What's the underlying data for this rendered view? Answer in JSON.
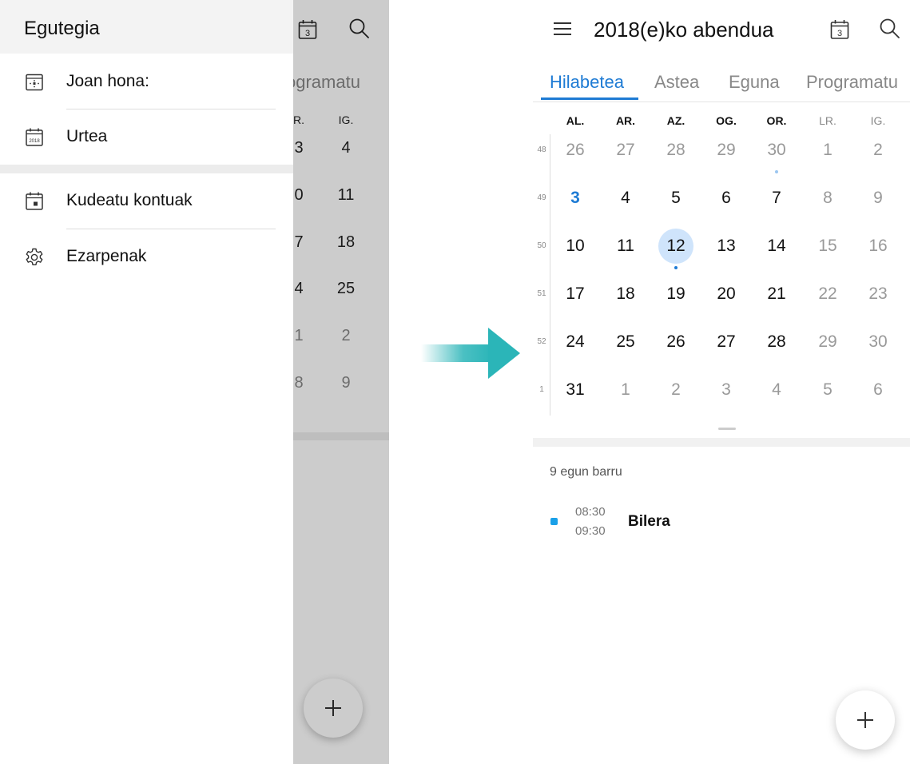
{
  "drawer": {
    "title": "Egutegia",
    "items": [
      {
        "label": "Joan hona:",
        "icon": "go-to-date-icon"
      },
      {
        "label": "Urtea",
        "icon": "year-calendar-icon",
        "icon_text": "2018"
      },
      {
        "label": "Kudeatu kontuak",
        "icon": "manage-accounts-calendar-icon"
      },
      {
        "label": "Ezarpenak",
        "icon": "gear-icon"
      }
    ]
  },
  "background": {
    "today_badge": "3",
    "tab_partial": "ogramatu",
    "weekdays": [
      "R.",
      "IG."
    ],
    "rows": [
      [
        "3",
        "4"
      ],
      [
        "0",
        "11"
      ],
      [
        "7",
        "18"
      ],
      [
        "4",
        "25"
      ],
      [
        "1",
        "2"
      ],
      [
        "8",
        "9"
      ]
    ]
  },
  "header": {
    "title": "2018(e)ko abendua",
    "today_badge": "3"
  },
  "tabs": [
    {
      "label": "Hilabetea",
      "active": true
    },
    {
      "label": "Astea",
      "active": false
    },
    {
      "label": "Eguna",
      "active": false
    },
    {
      "label": "Programatu",
      "active": false
    }
  ],
  "weekdays": [
    "AL.",
    "AR.",
    "AZ.",
    "OG.",
    "OR.",
    "LR.",
    "IG."
  ],
  "weeks": [
    {
      "number": "48",
      "days": [
        "26",
        "27",
        "28",
        "29",
        "30",
        "1",
        "2"
      ]
    },
    {
      "number": "49",
      "days": [
        "3",
        "4",
        "5",
        "6",
        "7",
        "8",
        "9"
      ]
    },
    {
      "number": "50",
      "days": [
        "10",
        "11",
        "12",
        "13",
        "14",
        "15",
        "16"
      ]
    },
    {
      "number": "51",
      "days": [
        "17",
        "18",
        "19",
        "20",
        "21",
        "22",
        "23"
      ]
    },
    {
      "number": "52",
      "days": [
        "24",
        "25",
        "26",
        "27",
        "28",
        "29",
        "30"
      ]
    },
    {
      "number": "1",
      "days": [
        "31",
        "1",
        "2",
        "3",
        "4",
        "5",
        "6"
      ]
    }
  ],
  "agenda": {
    "section_label": "9 egun barru",
    "events": [
      {
        "start": "08:30",
        "end": "09:30",
        "title": "Bilera",
        "color": "#1aa0e8"
      }
    ]
  },
  "colors": {
    "accent": "#1e7bd4",
    "selected_day_bg": "#cfe4fb",
    "arrow": "#2bb5b8"
  }
}
